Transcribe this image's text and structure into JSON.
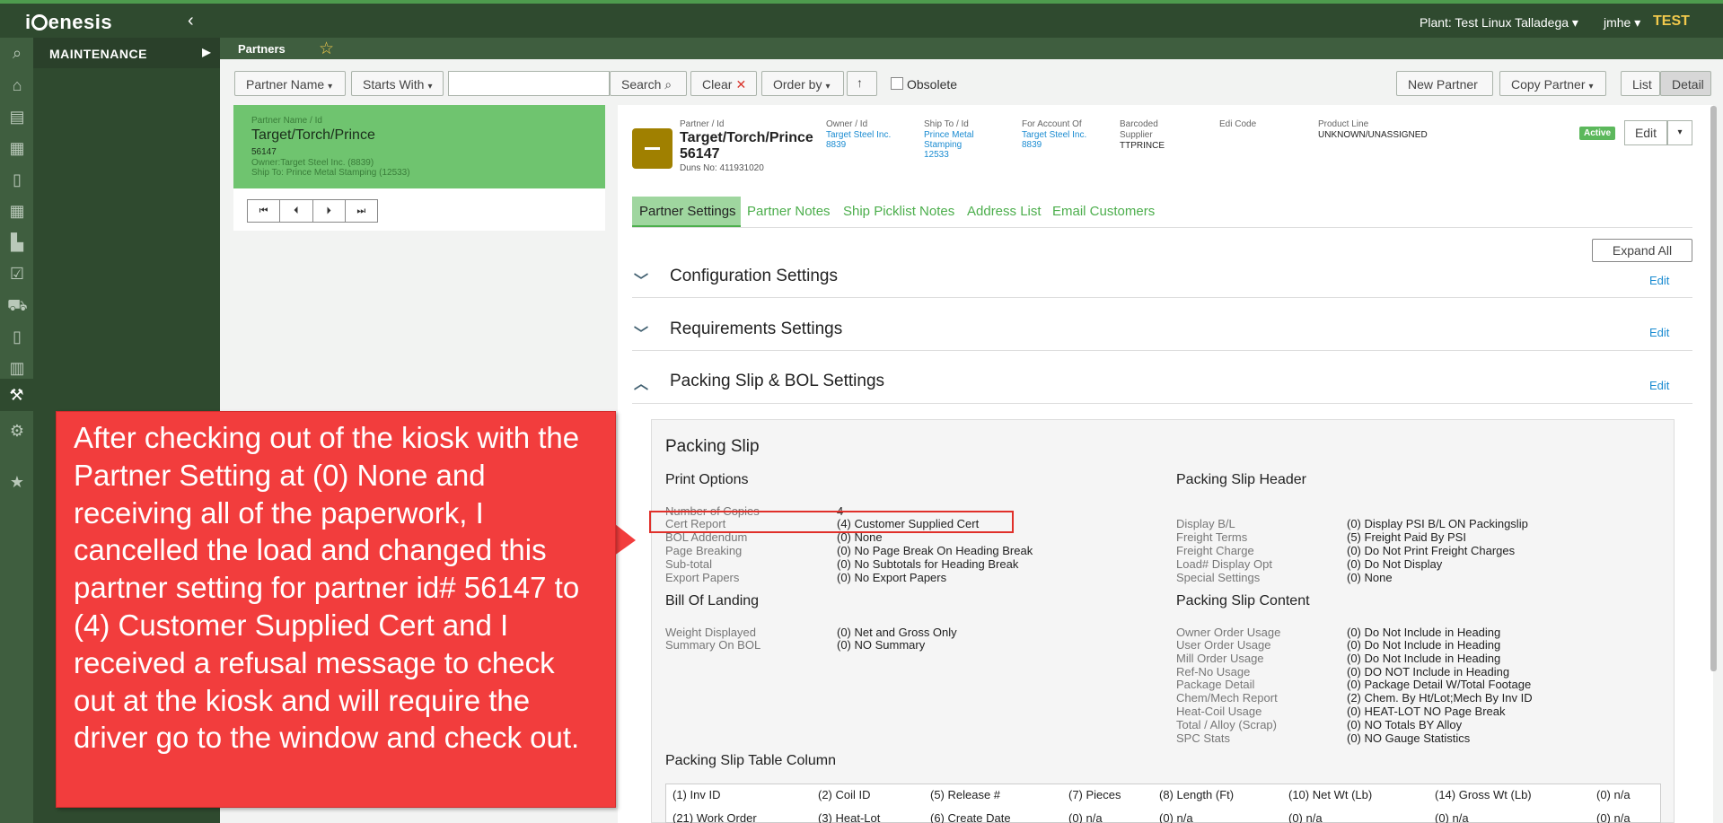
{
  "topbar": {
    "logo": "iGenesis",
    "plant": "Plant: Test Linux Talladega ▾",
    "user": "jmhe ▾",
    "env": "TEST"
  },
  "rail_icons": [
    "search-icon",
    "home-icon",
    "truck-loading-icon",
    "warehouse-icon",
    "document-icon",
    "calendar-icon",
    "factory-icon",
    "clipboard-check-icon",
    "truck-icon",
    "invoice-icon",
    "chart-icon",
    "wrench-icon",
    "gears-icon",
    "star-icon"
  ],
  "menu": {
    "header": "MAINTENANCE"
  },
  "titlebar": {
    "title": "Partners"
  },
  "toolbar": {
    "partner_name": "Partner Name",
    "starts_with": "Starts With",
    "search_value": "",
    "search": "Search",
    "clear": "Clear",
    "order_by": "Order by",
    "obsolete": "Obsolete",
    "new_partner": "New Partner",
    "copy_partner": "Copy Partner",
    "list": "List",
    "detail": "Detail"
  },
  "card": {
    "label": "Partner Name / Id",
    "name": "Target/Torch/Prince",
    "id": "56147",
    "owner": "Owner:Target Steel Inc. (8839)",
    "ship_to": "Ship To: Prince Metal Stamping (12533)"
  },
  "header": {
    "partner_label": "Partner / Id",
    "partner_name": "Target/Torch/Prince",
    "partner_id": "56147",
    "duns": "Duns No: 411931020",
    "owner_label": "Owner / Id",
    "owner_name": "Target Steel Inc.",
    "owner_id": "8839",
    "shipto_label": "Ship To / Id",
    "shipto_name_1": "Prince Metal",
    "shipto_name_2": "Stamping",
    "shipto_id": "12533",
    "account_label": "For Account Of",
    "account_name": "Target Steel Inc.",
    "account_id": "8839",
    "barcoded_label_1": "Barcoded",
    "barcoded_label_2": "Supplier",
    "barcoded_value": "TTPRINCE",
    "edi_label": "Edi Code",
    "product_label": "Product Line",
    "product_value": "UNKNOWN/UNASSIGNED",
    "status": "Active",
    "edit": "Edit"
  },
  "tabs": [
    "Partner Settings",
    "Partner Notes",
    "Ship Picklist Notes",
    "Address List",
    "Email Customers"
  ],
  "expand_all": "Expand All",
  "sections": {
    "config": "Configuration Settings",
    "requirements": "Requirements Settings",
    "packing": "Packing Slip & BOL Settings",
    "edit": "Edit"
  },
  "packing_slip": {
    "title": "Packing Slip",
    "print_options": "Print Options",
    "print_rows": [
      [
        "Number of Copies",
        "4"
      ],
      [
        "Cert Report",
        "(4) Customer Supplied Cert"
      ],
      [
        "BOL Addendum",
        "(0) None"
      ],
      [
        "Page Breaking",
        "(0) No Page Break On Heading Break"
      ],
      [
        "Sub-total",
        "(0) No Subtotals for Heading Break"
      ],
      [
        "Export Papers",
        "(0) No Export Papers"
      ]
    ],
    "bol": "Bill Of Landing",
    "bol_rows": [
      [
        "Weight Displayed",
        "(0) Net and Gross Only"
      ],
      [
        "Summary On BOL",
        "(0) NO Summary"
      ]
    ],
    "header_title": "Packing Slip Header",
    "header_rows": [
      [
        "Display B/L",
        "(0) Display PSI B/L ON Packingslip"
      ],
      [
        "Freight Terms",
        "(5) Freight Paid By PSI"
      ],
      [
        "Freight Charge",
        "(0) Do Not Print Freight Charges"
      ],
      [
        "Load# Display Opt",
        "(0) Do Not Display"
      ],
      [
        "Special Settings",
        "(0) None"
      ]
    ],
    "content_title": "Packing Slip Content",
    "content_rows": [
      [
        "Owner Order Usage",
        "(0) Do Not Include in Heading"
      ],
      [
        "User Order Usage",
        "(0) Do Not Include in Heading"
      ],
      [
        "Mill Order Usage",
        "(0) Do Not Include in Heading"
      ],
      [
        "Ref-No Usage",
        "(0) DO NOT Include in Heading"
      ],
      [
        "Package Detail",
        "(0) Package Detail W/Total Footage"
      ],
      [
        "Chem/Mech Report",
        "(2) Chem. By Ht/Lot;Mech By Inv ID"
      ],
      [
        "Heat-Coil Usage",
        "(0) HEAT-LOT NO Page Break"
      ],
      [
        "Total / Alloy (Scrap)",
        "(0) NO Totals BY Alloy"
      ],
      [
        "SPC Stats",
        "(0) NO Gauge Statistics"
      ]
    ],
    "table_title": "Packing Slip Table Column",
    "table_row1": [
      "(1) Inv ID",
      "(2) Coil ID",
      "(5) Release #",
      "(7) Pieces",
      "(8) Length (Ft)",
      "(10) Net Wt (Lb)",
      "(14) Gross Wt (Lb)",
      "(0) n/a"
    ],
    "table_row2": [
      "(21) Work Order",
      "(3) Heat-Lot",
      "(6) Create Date",
      "(0) n/a",
      "(0) n/a",
      "(0) n/a",
      "(0) n/a",
      "(0) n/a"
    ]
  },
  "callout": {
    "text": "After checking out of the kiosk with the Partner Setting at (0) None and receiving all of the paperwork, I cancelled the load and changed this partner setting for partner id# 56147 to (4) Customer Supplied Cert and I received a refusal message to check out at the kiosk and will require the driver go to the window and check out."
  }
}
